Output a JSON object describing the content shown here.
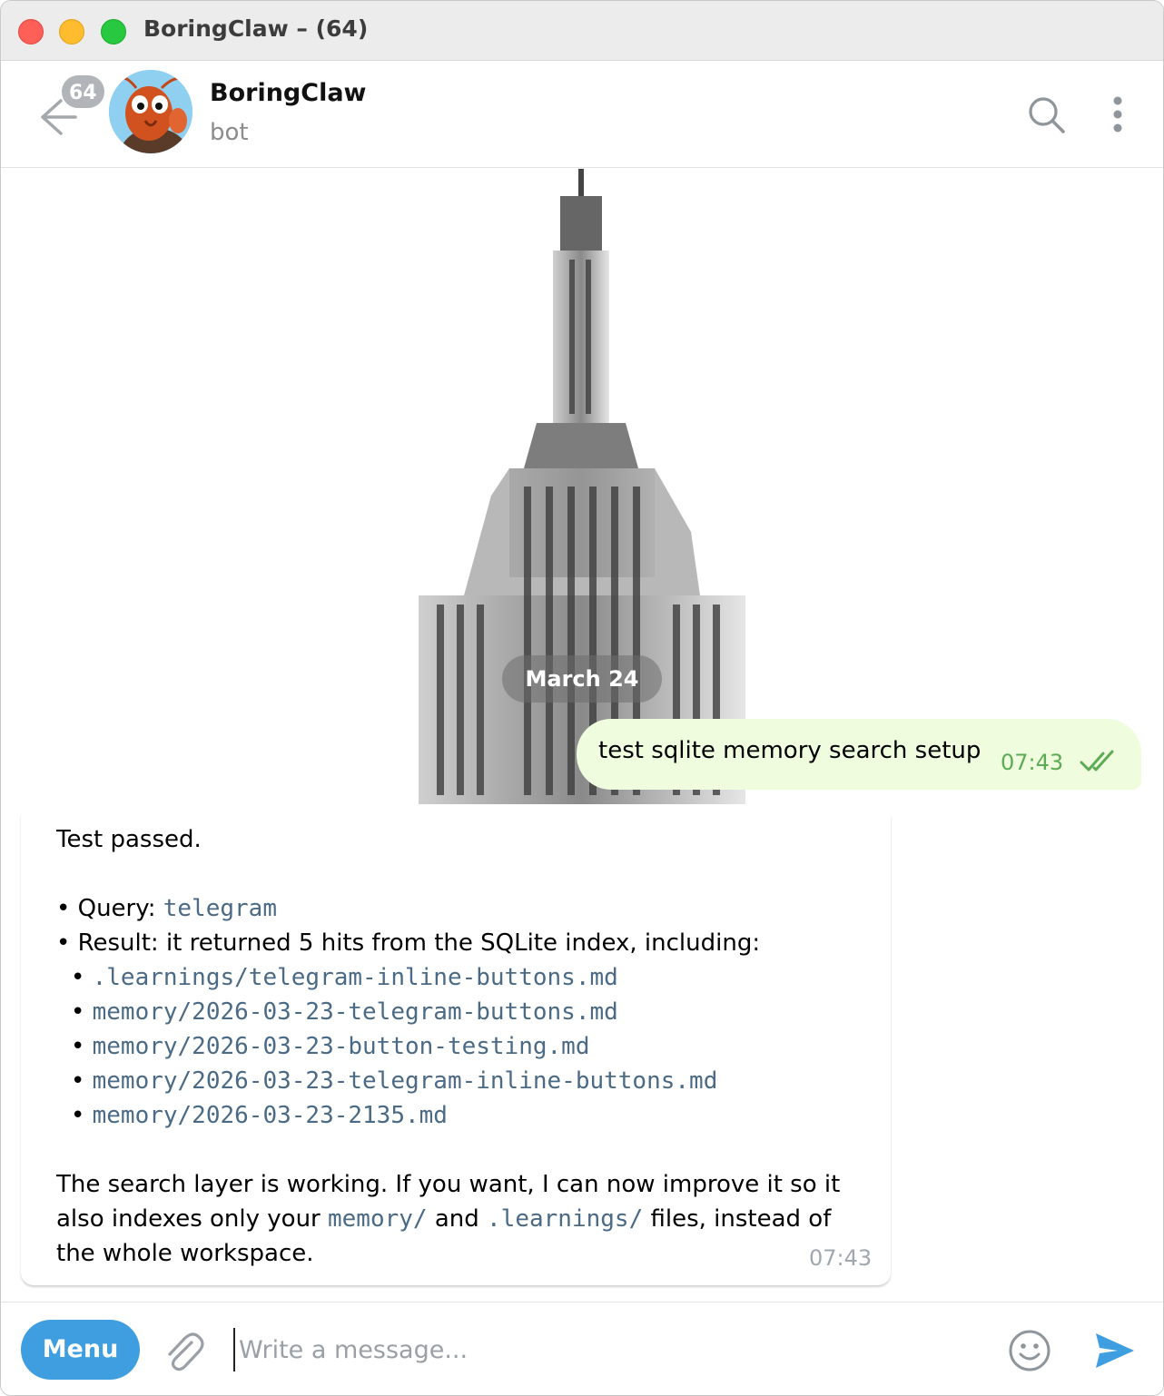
{
  "window": {
    "title": "BoringClaw – (64)"
  },
  "header": {
    "unread_count": "64",
    "chat_name": "BoringClaw",
    "chat_status": "bot",
    "icons": [
      "back-arrow-icon",
      "search-icon",
      "more-vertical-icon"
    ]
  },
  "chat": {
    "date_separator": "March 24",
    "outgoing": {
      "text": "test sqlite memory search setup",
      "time": "07:43",
      "status": "read"
    },
    "incoming": {
      "intro": "Test passed.",
      "query_label": "• Query: ",
      "query_value": "telegram",
      "result_line": "• Result: it returned 5 hits from the SQLite index, including:",
      "hits": [
        ".learnings/telegram-inline-buttons.md",
        "memory/2026-03-23-telegram-buttons.md",
        "memory/2026-03-23-button-testing.md",
        "memory/2026-03-23-telegram-inline-buttons.md",
        "memory/2026-03-23-2135.md"
      ],
      "outro_1": "The search layer is working. If you want, I can now improve it so it",
      "outro_2_a": "also indexes only your ",
      "outro_2_code1": "memory/",
      "outro_2_b": " and ",
      "outro_2_code2": ".learnings/",
      "outro_2_c": " files, instead of",
      "outro_3": "the whole workspace.",
      "time": "07:43"
    }
  },
  "composer": {
    "menu_label": "Menu",
    "placeholder": "Write a message...",
    "value": ""
  },
  "colors": {
    "accent": "#3f9ee0",
    "outgoing_bubble": "#effdde",
    "outgoing_time": "#5dab54",
    "code": "#4a6a85"
  }
}
